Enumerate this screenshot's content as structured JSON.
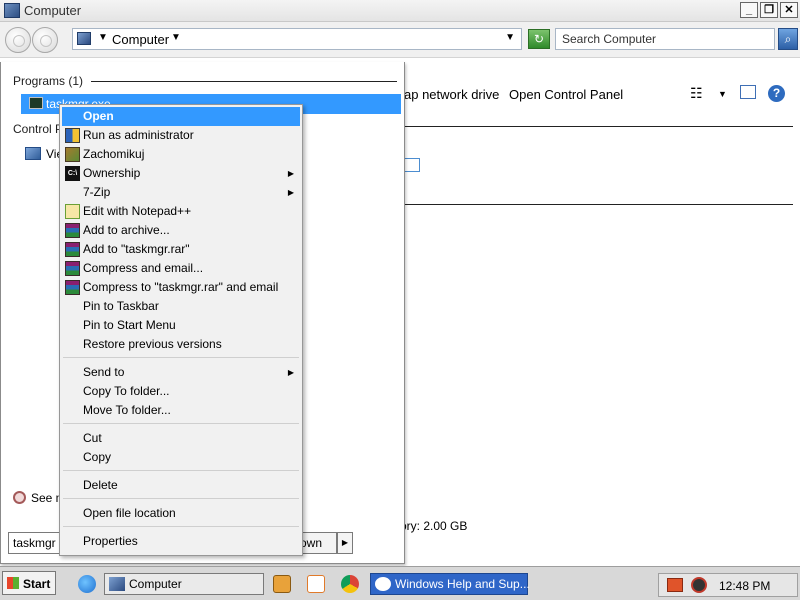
{
  "window": {
    "title": "Computer",
    "minimize_label": "_",
    "maximize_label": "❐",
    "close_label": "✕"
  },
  "address": {
    "path": "Computer",
    "dropdown_glyph": "▼",
    "refresh_glyph": "↻",
    "search_placeholder": "Search Computer",
    "search_glyph": "⌕"
  },
  "toolbar": {
    "map_drive": "ap network drive",
    "open_control_panel": "Open Control Panel",
    "views_glyph": "☷",
    "views_dropdown": "▼",
    "help_glyph": "?"
  },
  "details": {
    "memory_text": "ory: 2.00 GB"
  },
  "start_panel": {
    "programs_header": "Programs (1)",
    "result_label": "taskmgr.exe",
    "control_panel_header": "Control P",
    "control_panel_item": "Vie",
    "see_more": "See m",
    "search_value": "taskmgr",
    "shutdown_label": "own",
    "shutdown_arrow": "▶"
  },
  "context_menu": {
    "open": "Open",
    "run_as_admin": "Run as administrator",
    "zachomikuj": "Zachomikuj",
    "ownership": "Ownership",
    "seven_zip": "7-Zip",
    "edit_notepad": "Edit with Notepad++",
    "add_archive": "Add to archive...",
    "add_rar": "Add to \"taskmgr.rar\"",
    "compress_email": "Compress and email...",
    "compress_rar_email": "Compress to \"taskmgr.rar\" and email",
    "pin_taskbar": "Pin to Taskbar",
    "pin_start": "Pin to Start Menu",
    "restore": "Restore previous versions",
    "send_to": "Send to",
    "copy_to": "Copy To folder...",
    "move_to": "Move To folder...",
    "cut": "Cut",
    "copy": "Copy",
    "delete": "Delete",
    "open_location": "Open file location",
    "properties": "Properties",
    "submenu_glyph": "▶",
    "cmd_icon_text": "C:\\"
  },
  "taskbar": {
    "start_label": "Start",
    "tasks": [
      {
        "label": "Computer"
      },
      {
        "label": "Windows Help and Sup..."
      }
    ],
    "clock": "12:48 PM"
  },
  "colors": {
    "selection": "#3399ff",
    "menu_background": "#f1f1f1"
  }
}
